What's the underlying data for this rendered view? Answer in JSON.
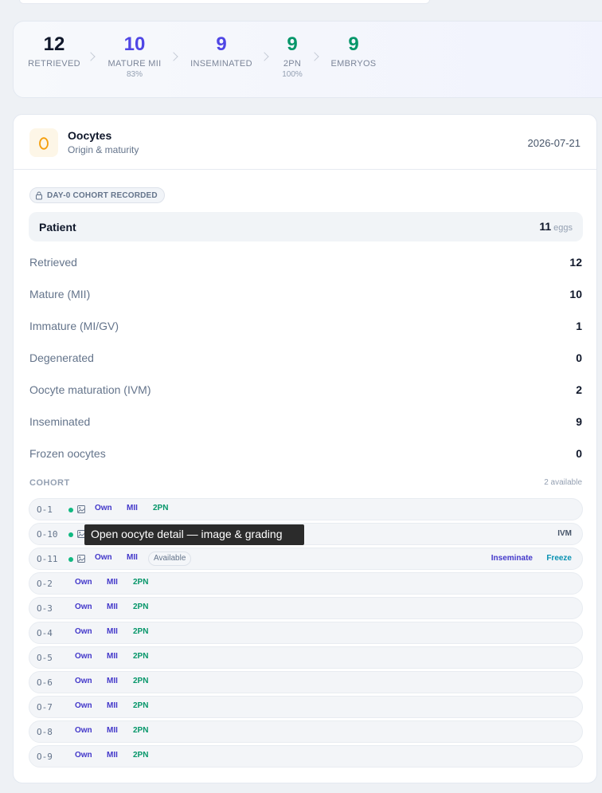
{
  "funnel": [
    {
      "value": "12",
      "label": "RETRIEVED",
      "sub": "",
      "color": "#0f172a"
    },
    {
      "value": "10",
      "label": "MATURE MII",
      "sub": "83%",
      "color": "#4f46e5"
    },
    {
      "value": "9",
      "label": "INSEMINATED",
      "sub": "",
      "color": "#4f46e5"
    },
    {
      "value": "9",
      "label": "2PN",
      "sub": "100%",
      "color": "#059669"
    },
    {
      "value": "9",
      "label": "EMBRYOS",
      "sub": "",
      "color": "#059669"
    }
  ],
  "card": {
    "title": "Oocytes",
    "subtitle": "Origin & maturity",
    "date": "2026-07-21",
    "icon": "egg-icon",
    "cohort_badge": "DAY-0 COHORT RECORDED"
  },
  "patient": {
    "label": "Patient",
    "count": "11",
    "unit": "eggs"
  },
  "stats": [
    {
      "label": "Retrieved",
      "value": "12"
    },
    {
      "label": "Mature (MII)",
      "value": "10"
    },
    {
      "label": "Immature (MI/GV)",
      "value": "1"
    },
    {
      "label": "Degenerated",
      "value": "0"
    },
    {
      "label": "Oocyte maturation (IVM)",
      "value": "2"
    },
    {
      "label": "Inseminated",
      "value": "9"
    },
    {
      "label": "Frozen oocytes",
      "value": "0"
    }
  ],
  "cohort": {
    "title": "COHORT",
    "available": "2 available",
    "rows": [
      {
        "id": "O-1",
        "origin": "Own",
        "maturity": "MII",
        "status": "2PN"
      },
      {
        "id": "O-10",
        "action": "IVM"
      },
      {
        "id": "O-11",
        "origin": "Own",
        "maturity": "MII",
        "status": "Available",
        "action1": "Inseminate",
        "action2": "Freeze"
      },
      {
        "id": "O-2",
        "origin": "Own",
        "maturity": "MII",
        "status": "2PN"
      },
      {
        "id": "O-3",
        "origin": "Own",
        "maturity": "MII",
        "status": "2PN"
      },
      {
        "id": "O-4",
        "origin": "Own",
        "maturity": "MII",
        "status": "2PN"
      },
      {
        "id": "O-5",
        "origin": "Own",
        "maturity": "MII",
        "status": "2PN"
      },
      {
        "id": "O-6",
        "origin": "Own",
        "maturity": "MII",
        "status": "2PN"
      },
      {
        "id": "O-7",
        "origin": "Own",
        "maturity": "MII",
        "status": "2PN"
      },
      {
        "id": "O-8",
        "origin": "Own",
        "maturity": "MII",
        "status": "2PN"
      },
      {
        "id": "O-9",
        "origin": "Own",
        "maturity": "MII",
        "status": "2PN"
      }
    ]
  },
  "tooltip": "Open oocyte detail — image & grading"
}
